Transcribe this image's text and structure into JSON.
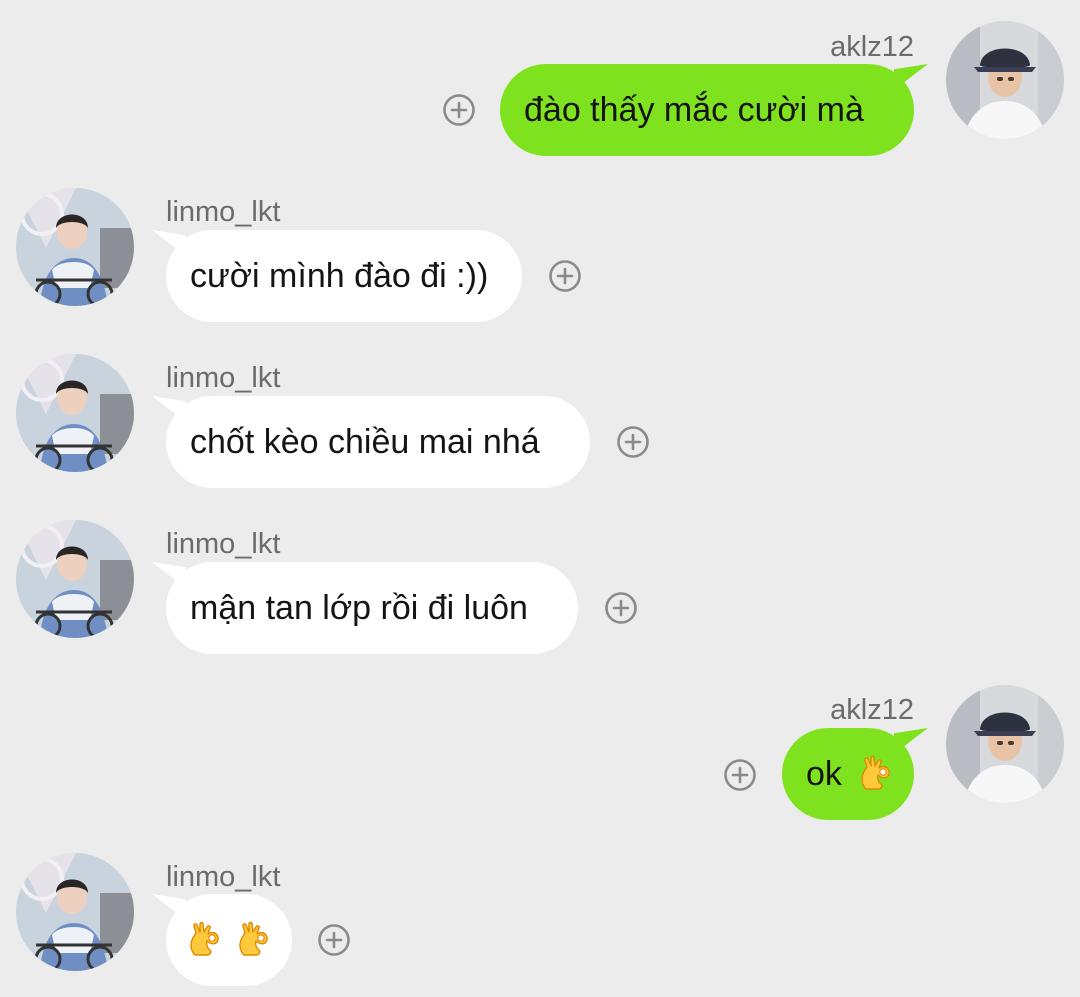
{
  "messages": [
    {
      "sender": "aklz12",
      "side": "out",
      "text": "đào thấy mắc cười mà",
      "emoji": []
    },
    {
      "sender": "linmo_lkt",
      "side": "in",
      "text": "cười mình đào đi :))",
      "emoji": []
    },
    {
      "sender": "linmo_lkt",
      "side": "in",
      "text": "chốt kèo chiều mai nhá",
      "emoji": []
    },
    {
      "sender": "linmo_lkt",
      "side": "in",
      "text": "mận tan lớp rồi đi luôn",
      "emoji": []
    },
    {
      "sender": "aklz12",
      "side": "out",
      "text": "ok",
      "emoji": [
        "ok-hand-emoji"
      ]
    },
    {
      "sender": "linmo_lkt",
      "side": "in",
      "text": "",
      "emoji": [
        "ok-hand-emoji",
        "ok-hand-emoji"
      ]
    }
  ],
  "icons": {
    "add_reaction": "plus-circle-icon",
    "avatar_outgoing": "avatar-bucket-hat",
    "avatar_incoming": "avatar-bicycle"
  },
  "colors": {
    "background": "#ececec",
    "outgoing_bubble": "#7ee31e",
    "incoming_bubble": "#ffffff",
    "username_text": "#6b6b6b",
    "icon_gray": "#8a8a8a"
  }
}
